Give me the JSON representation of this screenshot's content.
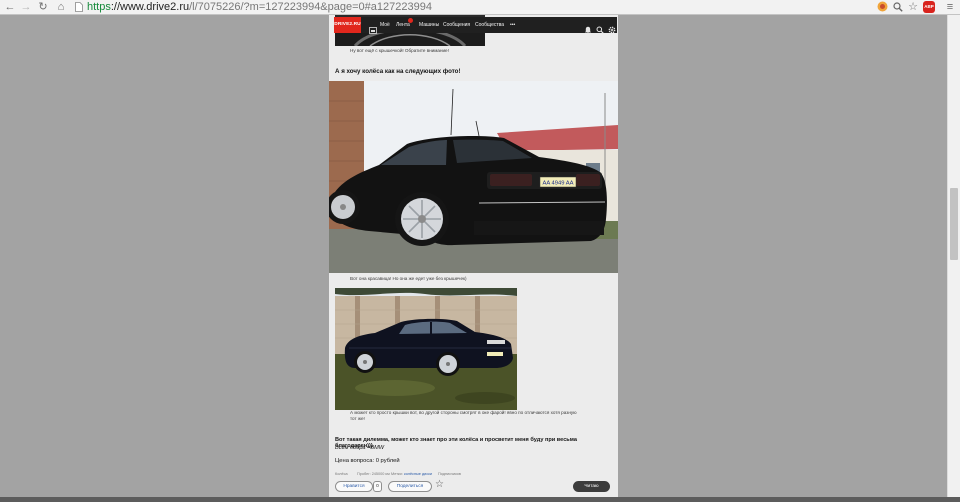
{
  "browser": {
    "url_scheme": "https",
    "url_host": "://www.drive2.ru",
    "url_path": "/l/7075226/?m=127223994&page=0#a127223994",
    "abp_label": "ABP"
  },
  "site_header": {
    "logo": "DRIVE2.RU",
    "nav": [
      {
        "label": "Моё"
      },
      {
        "label": "Лента"
      },
      {
        "label": "Машины"
      },
      {
        "label": "Сообщения"
      },
      {
        "label": "Сообщества"
      }
    ],
    "more": "•••"
  },
  "post": {
    "caption_1": "Ну вот ещё с крышечкой! Обратите внимание!",
    "intro": "А я хочу колёса как на следующих фото!",
    "photo_1_plate": "AA 4949 AA",
    "caption_2": "Вот она красавица! Но она же едет уже без крышечек)",
    "caption_3_line_1": "А может кто просто крышки вот, во другой стороны смотрят в оке фарой! явно по отличаются хотя разную",
    "caption_3_line_2": "тот же!",
    "question": "Вот такая дилемма, может кто знает про эти колёса и просветит меня буду при весьма благодарен)))",
    "signoff": "Всем добра =BMW",
    "price": "Цена вопроса: 0 рублей",
    "meta": {
      "category": "Колёса",
      "mileage": "Пробег: 245000 км",
      "tags_label": "Метки:",
      "tags_value": "колёсные диски",
      "subscribers": "Подписчиков"
    },
    "like_label": "Нравится",
    "like_count": "0",
    "share_label": "Поделиться",
    "follow_label": "Читаю"
  },
  "colors": {
    "brand_red": "#e1271d",
    "header_bg": "#202020",
    "page_bg": "#a3a3a3",
    "column_bg": "#ececec"
  }
}
